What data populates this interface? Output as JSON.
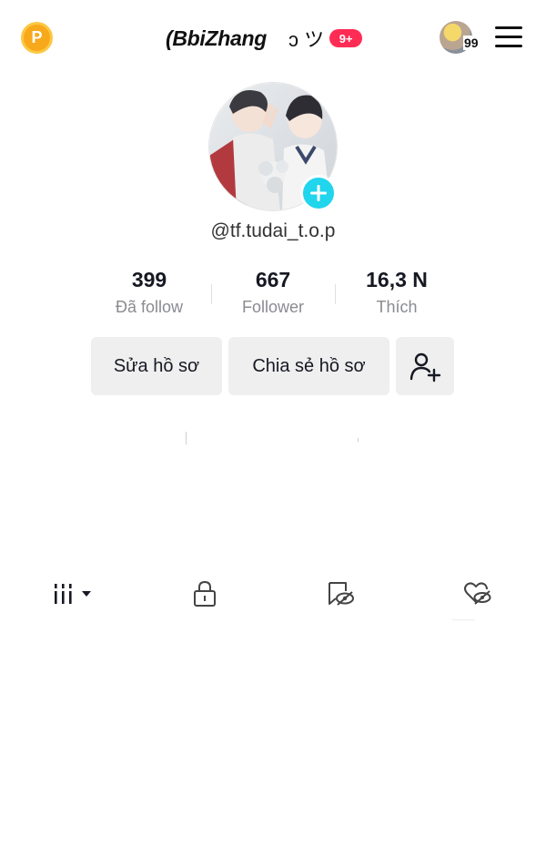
{
  "header": {
    "coin_letter": "P",
    "title": "(BbiZhang",
    "title_suffix": "ɔ ツ",
    "notification_badge": "9+",
    "avatar_count": "99",
    "coin_icon": "coin-p-icon",
    "menu_icon": "hamburger-menu-icon"
  },
  "profile": {
    "username": "@tf.tudai_t.o.p",
    "add_icon": "plus-icon"
  },
  "stats": [
    {
      "value": "399",
      "label": "Đã follow"
    },
    {
      "value": "667",
      "label": "Follower"
    },
    {
      "value": "16,3 N",
      "label": "Thích"
    }
  ],
  "actions": {
    "edit_profile": "Sửa hồ sơ",
    "share_profile": "Chia sẻ hồ sơ",
    "add_friend_icon": "add-person-icon"
  },
  "tabs": [
    {
      "name": "videos",
      "icon": "grid-bars-icon",
      "selected": true
    },
    {
      "name": "private",
      "icon": "lock-icon",
      "selected": false
    },
    {
      "name": "favorites-hidden",
      "icon": "bookmark-eye-off-icon",
      "selected": false
    },
    {
      "name": "liked-hidden",
      "icon": "heart-eye-off-icon",
      "selected": false
    }
  ],
  "colors": {
    "accent_pink": "#fe2c55",
    "add_button_cyan": "#20d5ec",
    "coin_orange": "#f8a91b",
    "button_gray": "#efefef",
    "secondary_text": "#8a8b91"
  }
}
